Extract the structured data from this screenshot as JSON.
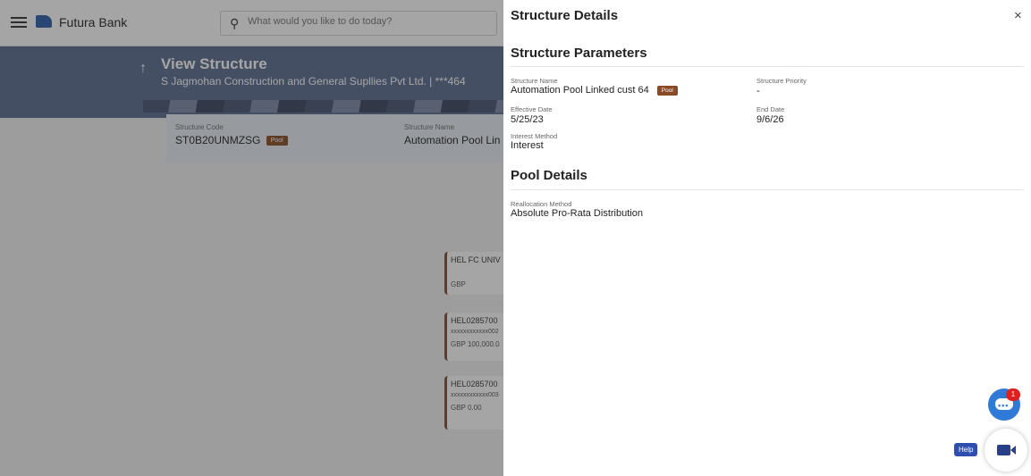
{
  "app": {
    "brand": "Futura Bank",
    "search_placeholder": "What would you like to do today?"
  },
  "page": {
    "title": "View Structure",
    "subtitle": "S Jagmohan Construction and General Supllies Pvt Ltd. | ***464"
  },
  "structure_card": {
    "code_label": "Structure Code",
    "code_value": "ST0B20UNMZSG",
    "code_badge": "Pool",
    "name_label": "Structure Name",
    "name_value": "Automation Pool Lin"
  },
  "nodes": [
    {
      "line1": "HEL FC UNIV",
      "line2": "",
      "line3": "GBP"
    },
    {
      "line1": "HEL0285700",
      "line2": "xxxxxxxxxxxx002",
      "line3": "GBP 100,000.0"
    },
    {
      "line1": "HEL0285700",
      "line2": "xxxxxxxxxxxx003",
      "line3": "GBP 0.00"
    }
  ],
  "drawer": {
    "title": "Structure Details",
    "close_glyph": "×",
    "parameters": {
      "heading": "Structure Parameters",
      "structure_name_label": "Structure Name",
      "structure_name_value": "Automation Pool Linked cust 64",
      "structure_name_badge": "Pool",
      "structure_priority_label": "Structure Priority",
      "structure_priority_value": "-",
      "effective_date_label": "Effective Date",
      "effective_date_value": "5/25/23",
      "end_date_label": "End Date",
      "end_date_value": "9/6/26",
      "interest_method_label": "Interest Method",
      "interest_method_value": "Interest"
    },
    "pool": {
      "heading": "Pool Details",
      "reallocation_label": "Reallocation Method",
      "reallocation_value": "Absolute Pro-Rata Distribution"
    }
  },
  "floating": {
    "chat_badge": "1",
    "chat_dots": "•••",
    "help_label": "Help"
  },
  "icons": {
    "menu": "hamburger-icon",
    "search": "search-icon",
    "back": "arrow-up-icon",
    "close": "close-icon",
    "chat": "chat-icon",
    "video": "video-camera-icon"
  },
  "colors": {
    "banner": "#5b6b8e",
    "pool_badge": "#8b4a23",
    "chat_button": "#2f7ad6",
    "help_tag": "#2f4fb0"
  }
}
